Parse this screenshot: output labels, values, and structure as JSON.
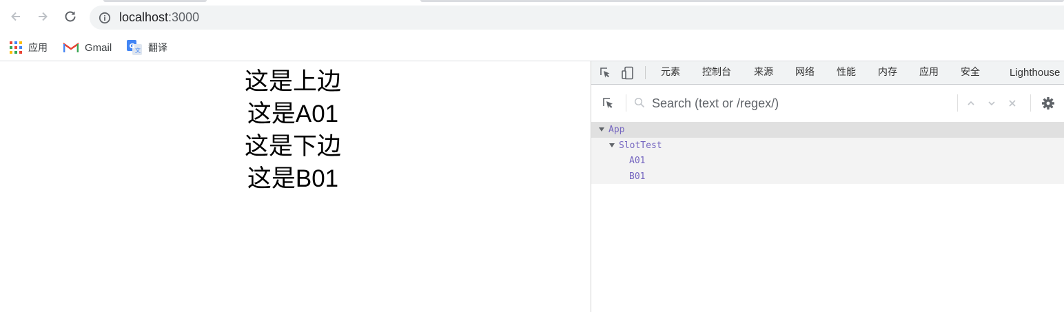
{
  "browser": {
    "url_host": "localhost",
    "url_port": ":3000",
    "bookmarks": [
      {
        "label": "应用",
        "icon": "apps-grid-icon"
      },
      {
        "label": "Gmail",
        "icon": "gmail-icon"
      },
      {
        "label": "翻译",
        "icon": "google-translate-icon"
      }
    ]
  },
  "page": {
    "lines": [
      "这是上边",
      "这是A01",
      "这是下边",
      "这是B01"
    ]
  },
  "devtools": {
    "tabs": [
      "元素",
      "控制台",
      "来源",
      "网络",
      "性能",
      "内存",
      "应用",
      "安全",
      "Lighthouse"
    ],
    "search_placeholder": "Search (text or /regex/)",
    "tree": [
      "App",
      "SlotTest",
      "A01",
      "B01"
    ]
  },
  "colors": {
    "component_name": "#7566c0",
    "omnibox_bg": "#f1f3f4",
    "selected_row": "#e0e0e0"
  }
}
